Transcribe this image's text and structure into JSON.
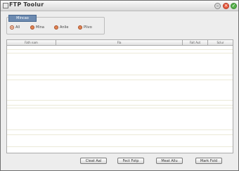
{
  "window": {
    "title": "FTP Toolur"
  },
  "filter": {
    "group_label": "Mincao",
    "options": [
      {
        "label": "All",
        "checked": true
      },
      {
        "label": "Mina",
        "checked": false
      },
      {
        "label": "Anlie",
        "checked": false
      },
      {
        "label": "Plivo",
        "checked": false
      }
    ]
  },
  "table": {
    "columns": [
      "Fath nam",
      "Fla",
      "Fait Aut",
      "Sclur"
    ],
    "rows": []
  },
  "buttons": {
    "clear_all": "Cleat Aal",
    "fetch_ftp": "Fect Fotp",
    "next_file": "Meat Allu",
    "mark_fold": "Mark Fold"
  }
}
